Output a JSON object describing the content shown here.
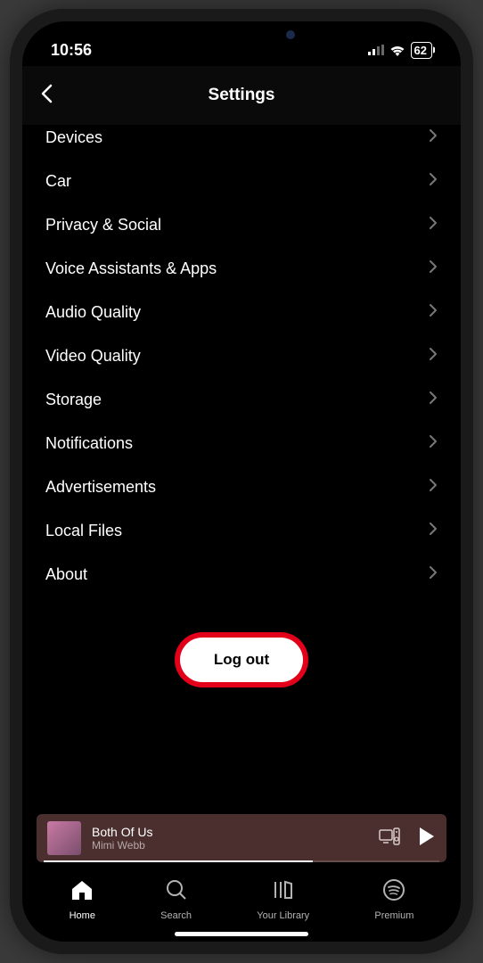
{
  "status": {
    "time": "10:56",
    "battery": "62"
  },
  "header": {
    "title": "Settings"
  },
  "settings": {
    "items": [
      {
        "label": "Devices"
      },
      {
        "label": "Car"
      },
      {
        "label": "Privacy & Social"
      },
      {
        "label": "Voice Assistants & Apps"
      },
      {
        "label": "Audio Quality"
      },
      {
        "label": "Video Quality"
      },
      {
        "label": "Storage"
      },
      {
        "label": "Notifications"
      },
      {
        "label": "Advertisements"
      },
      {
        "label": "Local Files"
      },
      {
        "label": "About"
      }
    ],
    "logout": "Log out"
  },
  "now_playing": {
    "title": "Both Of Us",
    "artist": "Mimi Webb"
  },
  "nav": {
    "items": [
      {
        "label": "Home"
      },
      {
        "label": "Search"
      },
      {
        "label": "Your Library"
      },
      {
        "label": "Premium"
      }
    ]
  }
}
